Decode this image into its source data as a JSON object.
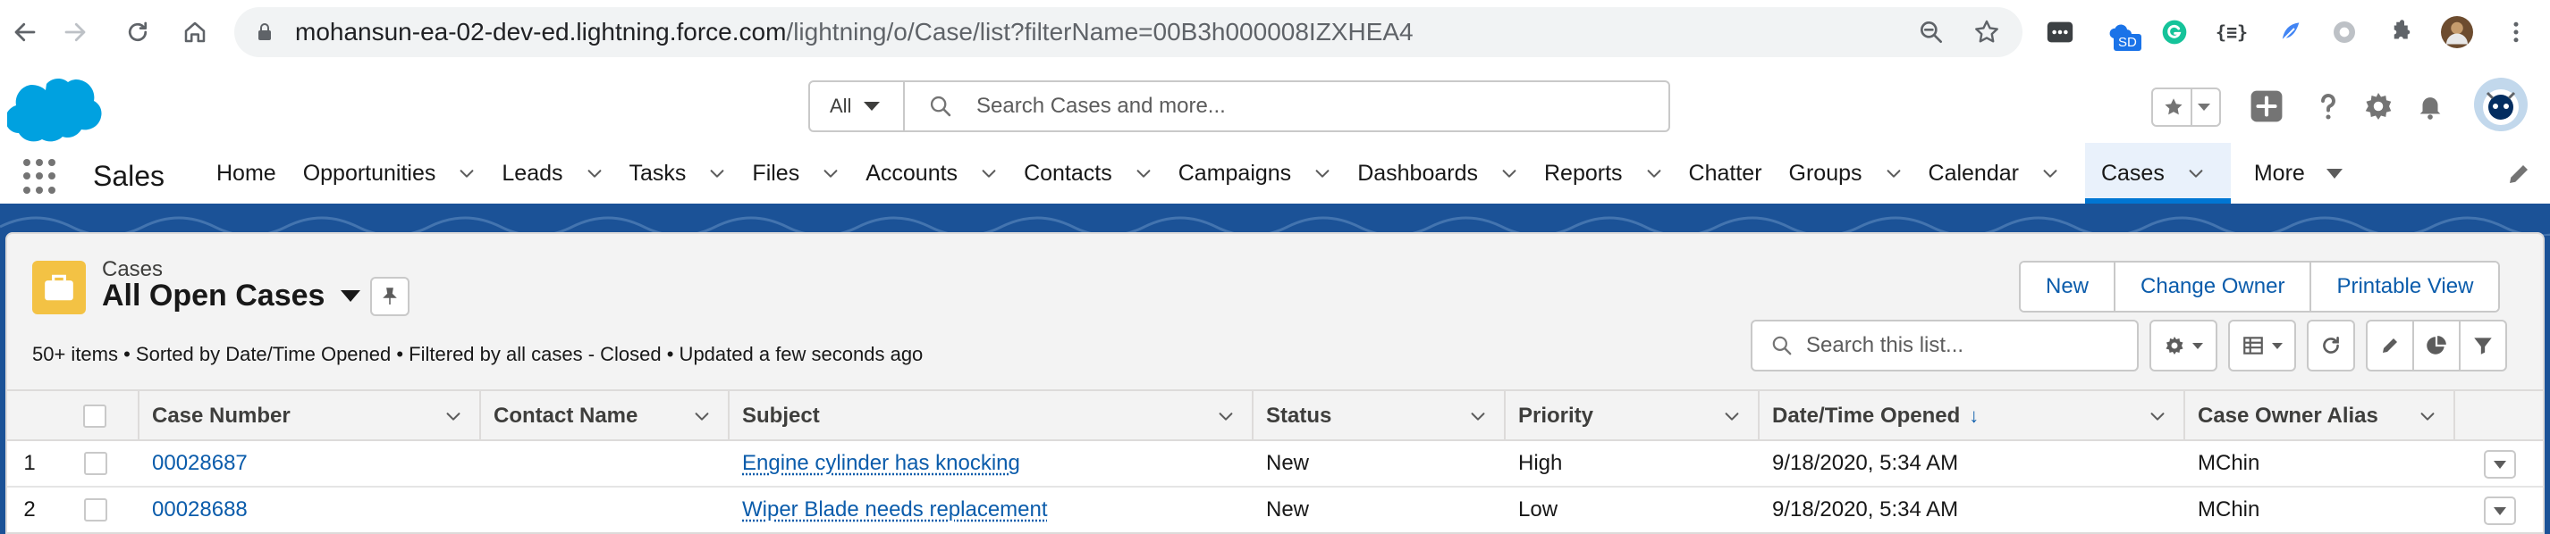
{
  "browser": {
    "url_host": "mohansun-ea-02-dev-ed.lightning.force.com",
    "url_path": "/lightning/o/Case/list?filterName=00B3h000008IZXHEA4",
    "extension_badge": "SD"
  },
  "header": {
    "search_scope": "All",
    "search_placeholder": "Search Cases and more...",
    "icons": [
      "favorites-icon",
      "add-icon",
      "help-icon",
      "setup-gear-icon",
      "notifications-bell-icon",
      "user-avatar"
    ]
  },
  "app_nav": {
    "app_name": "Sales",
    "items": [
      {
        "label": "Home",
        "has_menu": false
      },
      {
        "label": "Opportunities",
        "has_menu": true
      },
      {
        "label": "Leads",
        "has_menu": true
      },
      {
        "label": "Tasks",
        "has_menu": true
      },
      {
        "label": "Files",
        "has_menu": true
      },
      {
        "label": "Accounts",
        "has_menu": true
      },
      {
        "label": "Contacts",
        "has_menu": true
      },
      {
        "label": "Campaigns",
        "has_menu": true
      },
      {
        "label": "Dashboards",
        "has_menu": true
      },
      {
        "label": "Reports",
        "has_menu": true
      },
      {
        "label": "Chatter",
        "has_menu": false
      },
      {
        "label": "Groups",
        "has_menu": true
      },
      {
        "label": "Calendar",
        "has_menu": true
      },
      {
        "label": "Cases",
        "has_menu": true,
        "active": true
      }
    ],
    "more_label": "More"
  },
  "list_view": {
    "object_label": "Cases",
    "title": "All Open Cases",
    "info": "50+ items • Sorted by Date/Time Opened • Filtered by all cases - Closed • Updated a few seconds ago",
    "buttons": {
      "new": "New",
      "change_owner": "Change Owner",
      "printable_view": "Printable View"
    },
    "search_placeholder": "Search this list..."
  },
  "table": {
    "columns": [
      "Case Number",
      "Contact Name",
      "Subject",
      "Status",
      "Priority",
      "Date/Time Opened",
      "Case Owner Alias"
    ],
    "sorted_indicator": "↓",
    "rows": [
      {
        "num": "1",
        "case_number": "00028687",
        "contact_name": "",
        "subject": "Engine cylinder has knocking",
        "status": "New",
        "priority": "High",
        "opened": "9/18/2020, 5:34 AM",
        "owner": "MChin"
      },
      {
        "num": "2",
        "case_number": "00028688",
        "contact_name": "",
        "subject": "Wiper Blade needs replacement",
        "status": "New",
        "priority": "Low",
        "opened": "9/18/2020, 5:34 AM",
        "owner": "MChin"
      }
    ]
  },
  "colors": {
    "brand_blue": "#1b5297",
    "link_blue": "#0b5cab",
    "case_icon_yellow": "#f3c244",
    "active_tab_bg": "#e9f1fb"
  }
}
